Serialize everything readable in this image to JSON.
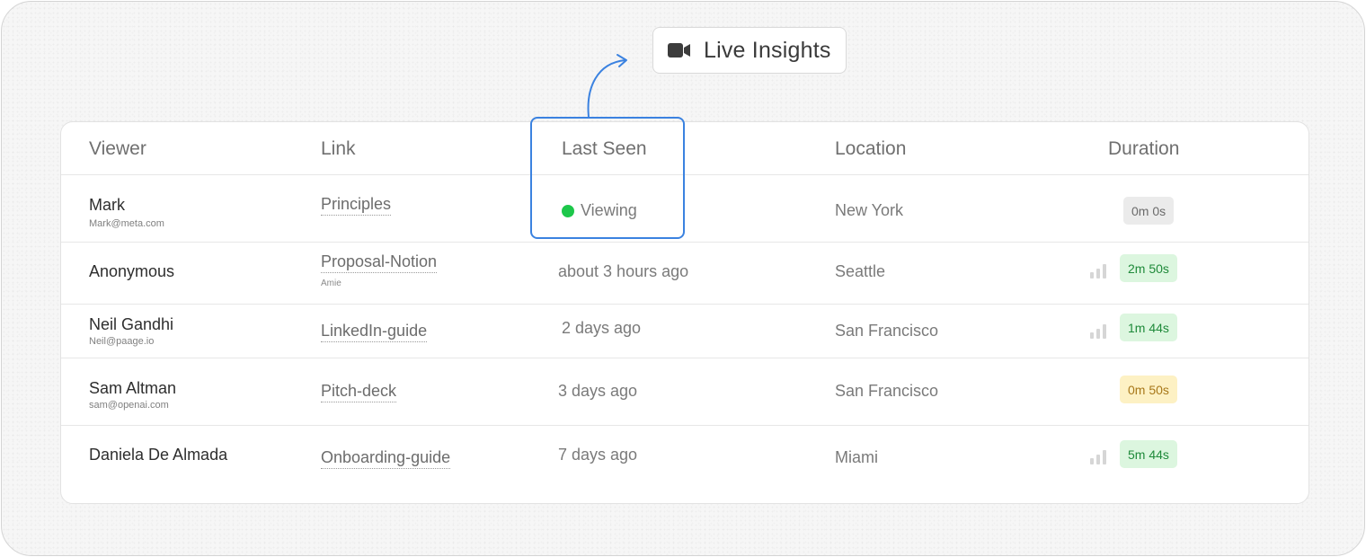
{
  "live_insights": {
    "label": "Live Insights",
    "icon": "video-camera-icon"
  },
  "table": {
    "headers": {
      "viewer": "Viewer",
      "link": "Link",
      "last_seen": "Last Seen",
      "location": "Location",
      "duration": "Duration"
    },
    "rows": [
      {
        "name": "Mark",
        "email": "Mark@meta.com",
        "link": "Principles",
        "link_sub": "",
        "last_seen": "Viewing",
        "location": "New York",
        "duration": "0m 0s",
        "duration_color": "#ebebeb"
      },
      {
        "name": "Anonymous",
        "email": "",
        "link": "Proposal-Notion",
        "link_sub": "Amie",
        "last_seen": "about 3 hours ago",
        "location": "Seattle",
        "duration": "2m 50s",
        "duration_color": "#dcf6df"
      },
      {
        "name": "Neil Gandhi",
        "email": "Neil@paage.io",
        "link": "LinkedIn-guide",
        "link_sub": "",
        "last_seen": "2 days ago",
        "location": "San Francisco",
        "duration": "1m 44s",
        "duration_color": "#dcf6df"
      },
      {
        "name": "Sam Altman",
        "email": "sam@openai.com",
        "link": "Pitch-deck",
        "link_sub": "",
        "last_seen": "3 days ago",
        "location": "San Francisco",
        "duration": "0m 50s",
        "duration_color": "#fdf1c4"
      },
      {
        "name": "Daniela De Almada",
        "email": "",
        "link": "Onboarding-guide",
        "link_sub": "",
        "last_seen": "7 days ago",
        "location": "Miami",
        "duration": "5m 44s",
        "duration_color": "#dcf6df"
      }
    ]
  },
  "colors": {
    "highlight_border": "#3b82e0",
    "viewing_dot": "#1dc74a",
    "duration_green_text": "#1f8a3a",
    "duration_yellow_text": "#a8781a"
  }
}
